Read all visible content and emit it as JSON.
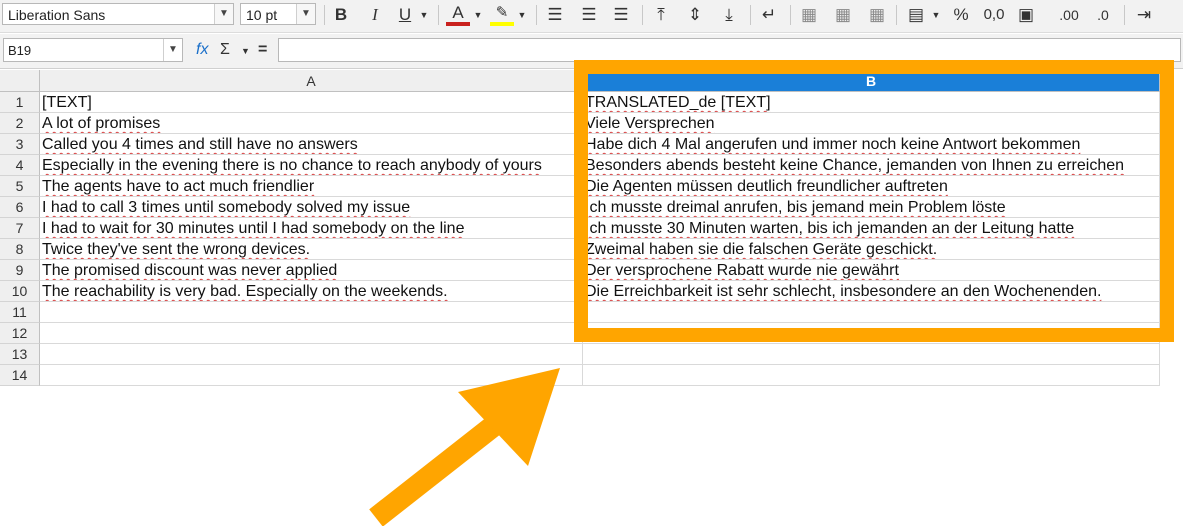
{
  "toolbar": {
    "font_name": "Liberation Sans",
    "font_size": "10 pt",
    "bold": "B",
    "italic": "I",
    "underline": "U",
    "font_color": "A",
    "percent": "%",
    "zero": "0,0",
    "add_decimal": ".00",
    "remove_decimal": ".0"
  },
  "formula_bar": {
    "name_box": "B19",
    "function_wizard": "fx",
    "sum": "Σ",
    "equals": "=",
    "content": ""
  },
  "columns": [
    "A",
    "B"
  ],
  "rows": [
    {
      "num": "1",
      "a": "[TEXT]",
      "b": "TRANSLATED_de [TEXT]"
    },
    {
      "num": "2",
      "a": "A lot of promises",
      "b": "Viele Versprechen"
    },
    {
      "num": "3",
      "a": "Called you 4 times and still have no answers",
      "b": "Habe dich 4 Mal angerufen und immer noch keine Antwort bekommen"
    },
    {
      "num": "4",
      "a": "Especially in the evening there is no chance to reach anybody of yours",
      "b": "Besonders abends besteht keine Chance, jemanden von Ihnen zu erreichen"
    },
    {
      "num": "5",
      "a": "The agents have to act much friendlier",
      "b": "Die Agenten müssen deutlich freundlicher auftreten"
    },
    {
      "num": "6",
      "a": "I had to call 3 times until somebody solved my issue",
      "b": "Ich musste dreimal anrufen, bis jemand mein Problem löste"
    },
    {
      "num": "7",
      "a": "I had to wait for 30 minutes until I had somebody on the line",
      "b": "Ich musste 30 Minuten warten, bis ich jemanden an der Leitung hatte"
    },
    {
      "num": "8",
      "a": "Twice they've sent the wrong devices.",
      "b": "Zweimal haben sie die falschen Geräte geschickt."
    },
    {
      "num": "9",
      "a": "The promised discount was never applied",
      "b": "Der versprochene Rabatt wurde nie gewährt"
    },
    {
      "num": "10",
      "a": "The reachability is very bad. Especially on the weekends.",
      "b": "Die Erreichbarkeit ist sehr schlecht, insbesondere an den Wochenenden."
    },
    {
      "num": "11",
      "a": "",
      "b": ""
    },
    {
      "num": "12",
      "a": "",
      "b": ""
    },
    {
      "num": "13",
      "a": "",
      "b": ""
    },
    {
      "num": "14",
      "a": "",
      "b": ""
    }
  ],
  "colors": {
    "highlight": "#ffa500",
    "selected_column": "#1a7fd8"
  }
}
